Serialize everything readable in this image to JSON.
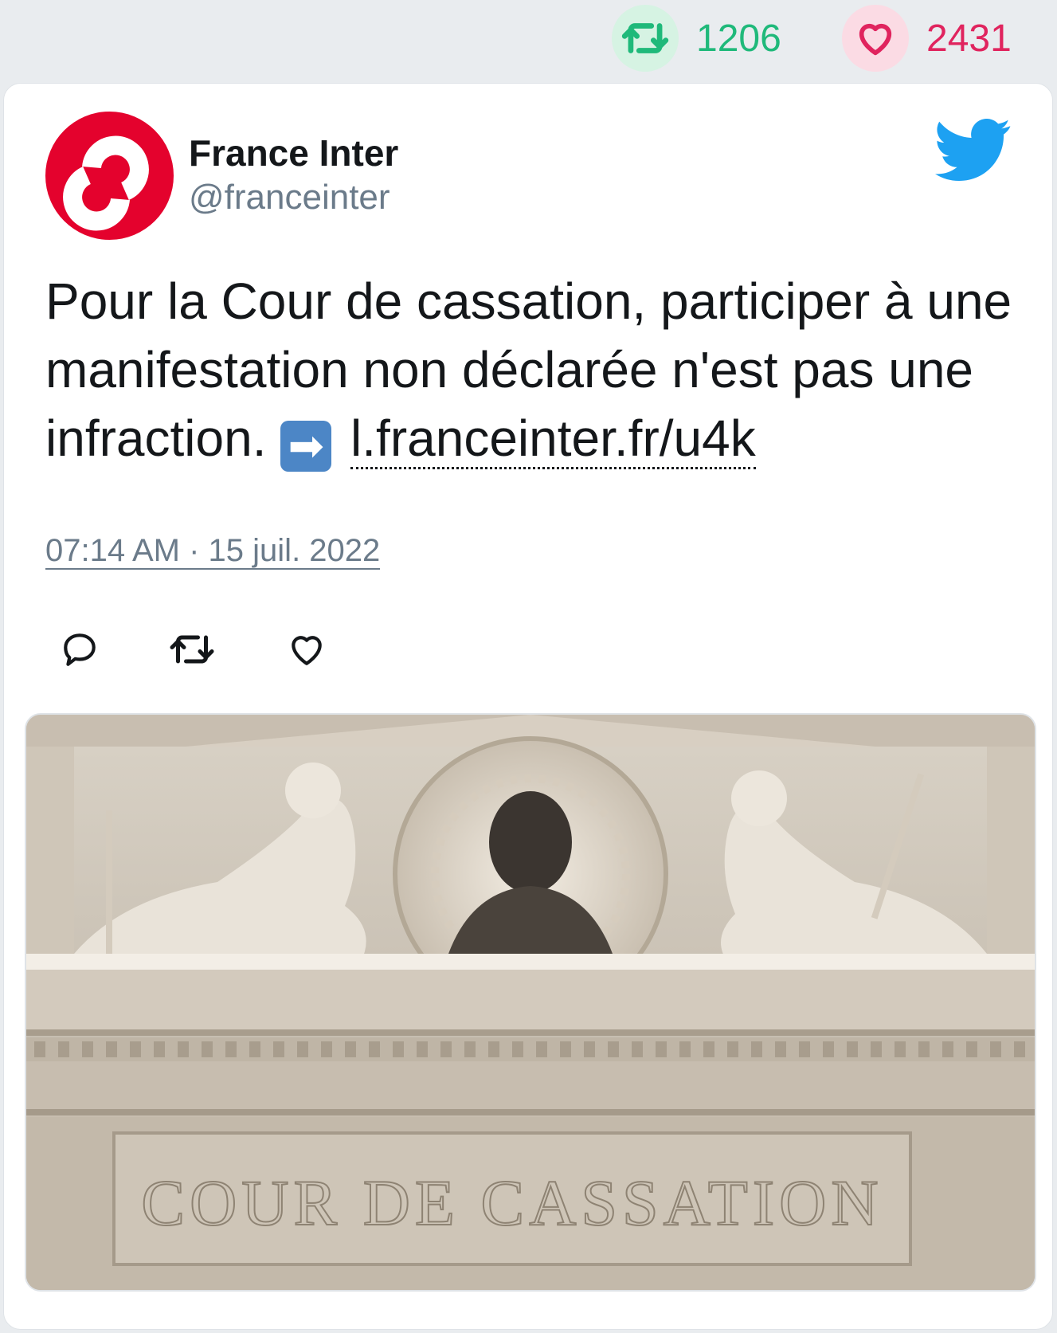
{
  "stats": {
    "retweet_count": "1206",
    "like_count": "2431",
    "retweet_icon": "retweet-icon",
    "like_icon": "heart-icon",
    "retweet_color": "#1fb97a",
    "like_color": "#e0245e"
  },
  "tweet": {
    "author_name": "France Inter",
    "author_handle": "@franceinter",
    "text_main": "Pour la Cour de cassation, participer à une manifestation non déclarée n'est pas une infraction.",
    "arrow_emoji": "➡",
    "link_text": "l.franceinter.fr/u4k",
    "timestamp": "07:14 AM · 15 juil. 2022",
    "brand_color": "#e4022d",
    "twitter_color": "#1da1f2"
  },
  "actions": {
    "reply_icon": "reply-icon",
    "retweet_icon": "retweet-icon",
    "like_icon": "heart-icon"
  },
  "photo": {
    "inscription": "COUR DE CASSATION"
  }
}
